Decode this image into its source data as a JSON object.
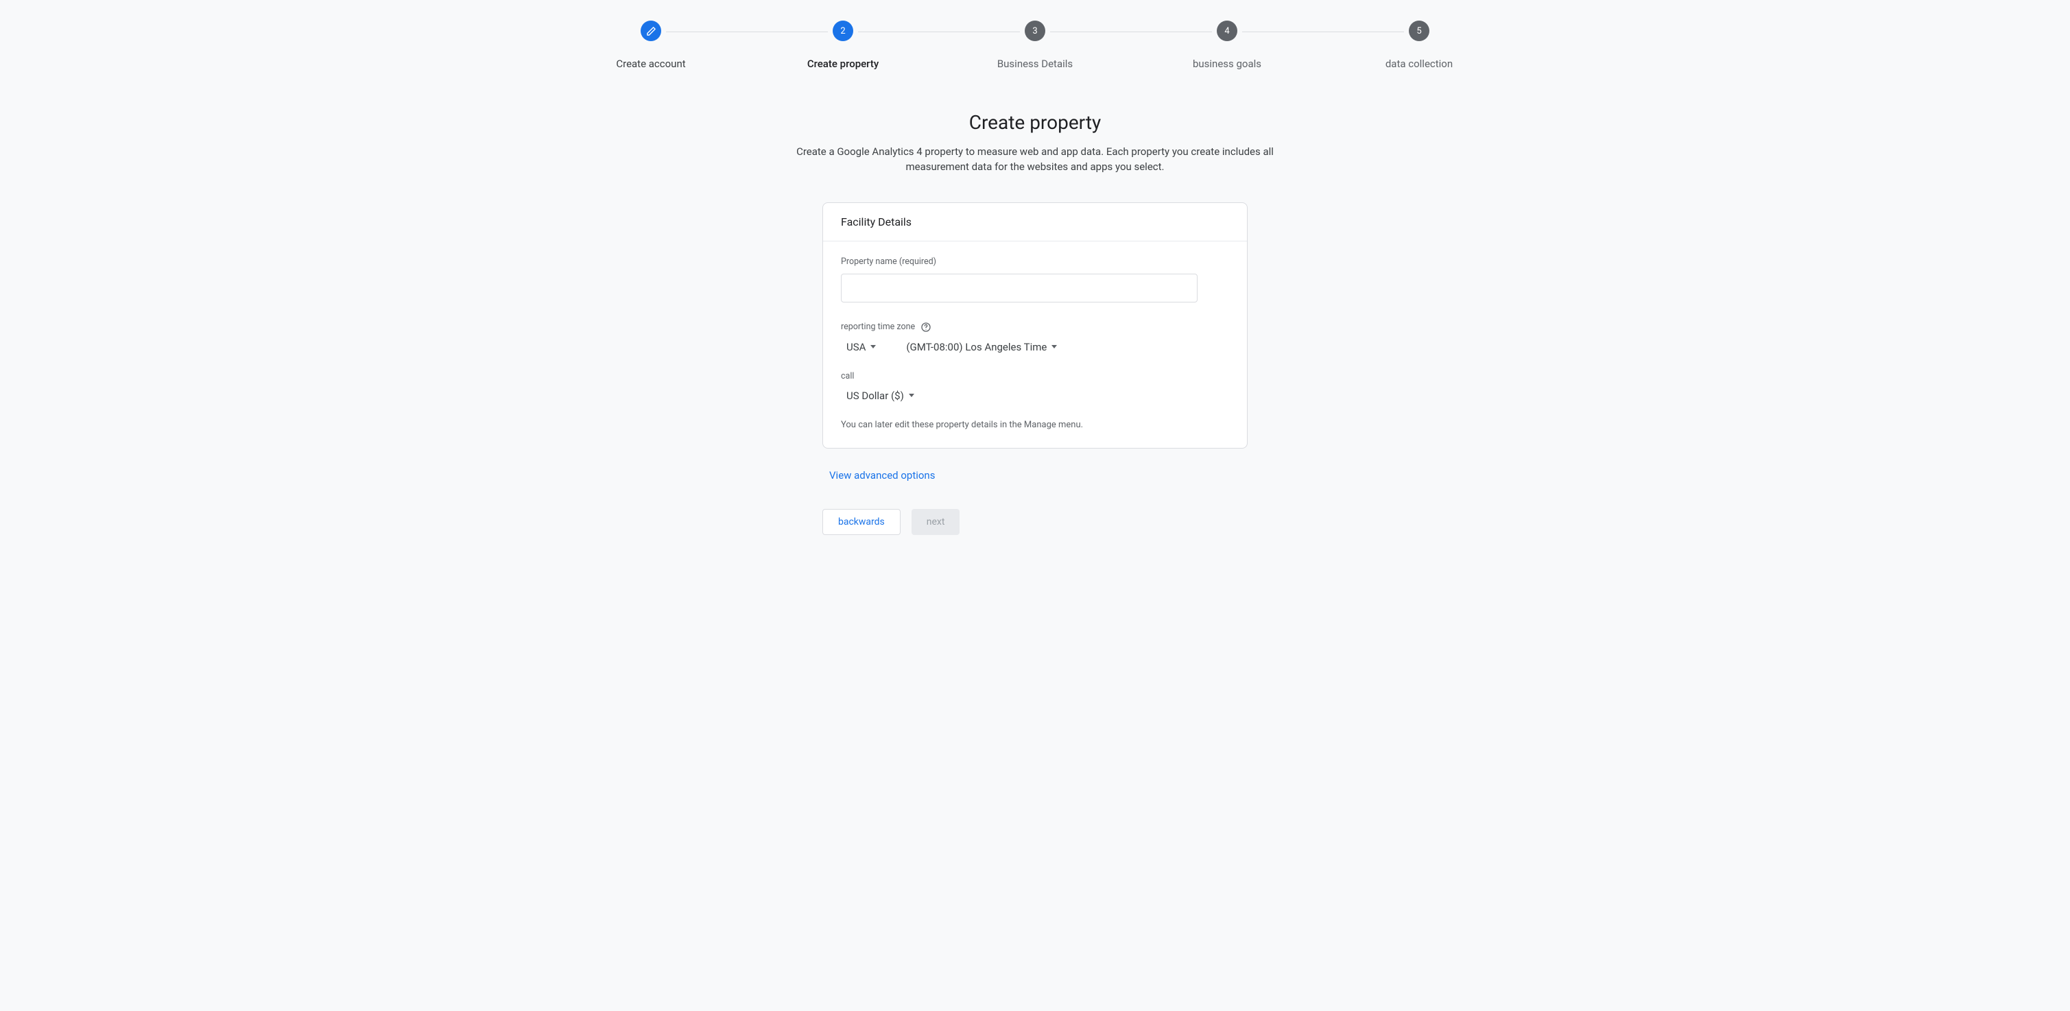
{
  "stepper": {
    "steps": [
      {
        "label": "Create account",
        "state": "completed"
      },
      {
        "label": "Create property",
        "state": "active",
        "num": "2"
      },
      {
        "label": "Business Details",
        "state": "pending",
        "num": "3"
      },
      {
        "label": "business goals",
        "state": "pending",
        "num": "4"
      },
      {
        "label": "data collection",
        "state": "pending",
        "num": "5"
      }
    ]
  },
  "page": {
    "title": "Create property",
    "subtitle": "Create a Google Analytics 4 property to measure web and app data. Each property you create includes all measurement data for the websites and apps you select."
  },
  "card": {
    "header": "Facility Details",
    "property_name_label": "Property name (required)",
    "property_name_value": "",
    "timezone_label": "reporting time zone",
    "country_value": "USA",
    "timezone_value": "(GMT-08:00) Los Angeles Time",
    "currency_label": "call",
    "currency_value": "US Dollar ($)",
    "footer_hint": "You can later edit these property details in the Manage menu."
  },
  "advanced_link": "View advanced options",
  "buttons": {
    "back": "backwards",
    "next": "next"
  }
}
